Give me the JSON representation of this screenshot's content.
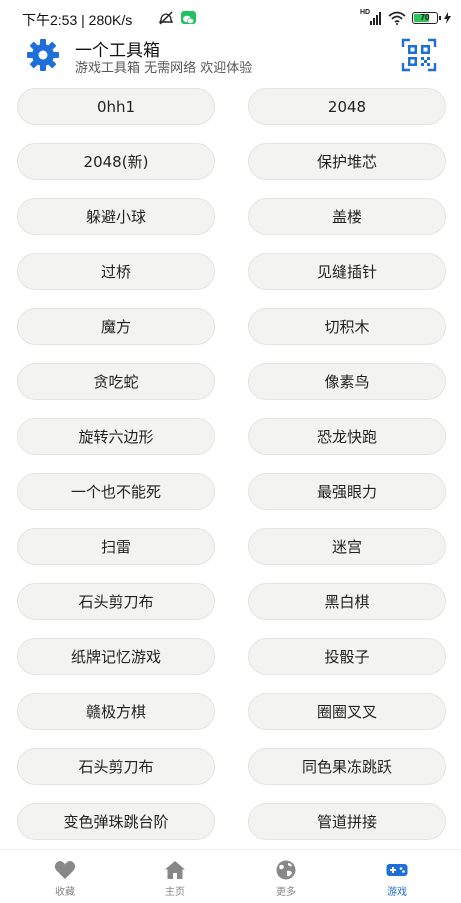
{
  "status_bar": {
    "time": "下午2:53 | 280K/s",
    "hd_label": "HD",
    "battery_level": "70",
    "battery_fraction": 0.7,
    "icons": [
      "silent-icon",
      "wechat-icon",
      "hd-signal-icon",
      "wifi-icon",
      "battery-icon",
      "charging-icon"
    ]
  },
  "header": {
    "title": "一个工具箱",
    "subtitle": "游戏工具箱 无需网络 欢迎体验",
    "settings_icon": "gear-icon",
    "scan_icon": "qr-scan-icon"
  },
  "games": [
    "0hh1",
    "2048",
    "2048(新)",
    "保护堆芯",
    "躲避小球",
    "盖楼",
    "过桥",
    "见缝插针",
    "魔方",
    "切积木",
    "贪吃蛇",
    "像素鸟",
    "旋转六边形",
    "恐龙快跑",
    "一个也不能死",
    "最强眼力",
    "扫雷",
    "迷宫",
    "石头剪刀布",
    "黑白棋",
    "纸牌记忆游戏",
    "投骰子",
    "赣极方棋",
    "圈圈叉叉",
    "石头剪刀布",
    "同色果冻跳跃",
    "变色弹珠跳台阶",
    "管道拼接"
  ],
  "bottom_nav": {
    "items": [
      {
        "label": "收藏",
        "icon": "heart-icon",
        "active": false
      },
      {
        "label": "主页",
        "icon": "home-icon",
        "active": false
      },
      {
        "label": "更多",
        "icon": "globe-icon",
        "active": false
      },
      {
        "label": "游戏",
        "icon": "gamepad-icon",
        "active": true
      }
    ]
  },
  "colors": {
    "accent": "#1e6fd9",
    "button_bg": "#f3f4f1",
    "battery_green": "#2fc45b",
    "wechat_green": "#22c160",
    "nav_inactive": "#888888"
  }
}
